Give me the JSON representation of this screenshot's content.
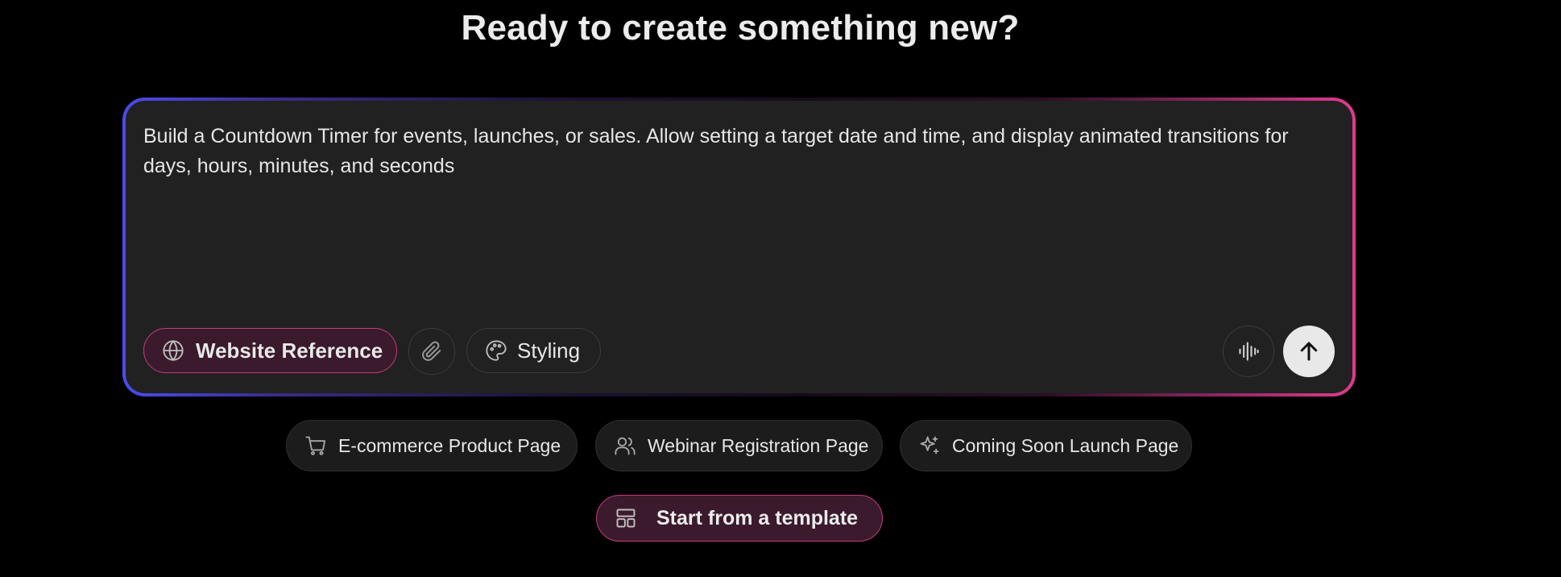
{
  "heading": "Ready to create something new?",
  "prompt": {
    "text": "Build a Countdown Timer for events, launches, or sales. Allow setting a target date and time, and display animated transitions for days, hours, minutes, and seconds"
  },
  "toolbar": {
    "website_reference_label": "Website Reference",
    "styling_label": "Styling"
  },
  "suggestions": [
    {
      "label": "E-commerce Product Page",
      "icon": "cart-icon"
    },
    {
      "label": "Webinar Registration Page",
      "icon": "users-icon"
    },
    {
      "label": "Coming Soon Launch Page",
      "icon": "sparkles-icon"
    }
  ],
  "template_button": {
    "label": "Start from a template",
    "icon": "layout-icon"
  },
  "colors": {
    "background": "#000000",
    "panel": "#212121",
    "accent_pink": "#c23d7c",
    "gradient_start": "#4a4cf0",
    "gradient_end": "#e03b8f"
  }
}
